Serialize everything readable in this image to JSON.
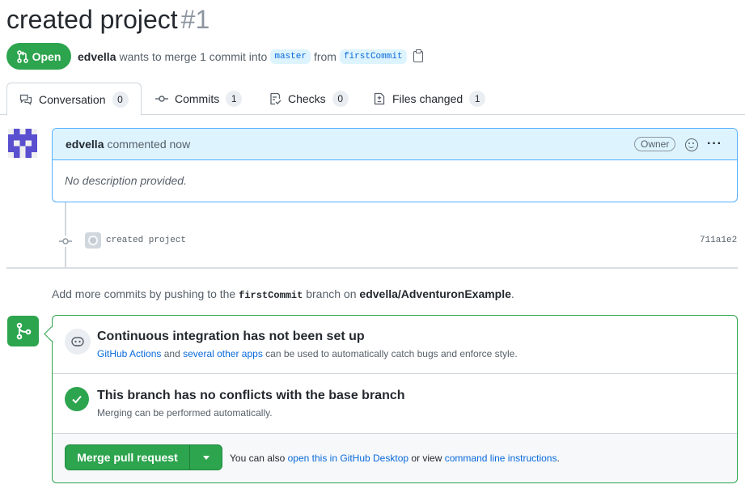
{
  "header": {
    "title": "created project",
    "number": "#1",
    "state": "Open",
    "author": "edvella",
    "meta_text": "wants to merge 1 commit into",
    "base_branch": "master",
    "from_text": "from",
    "head_branch": "firstCommit"
  },
  "tabs": [
    {
      "label": "Conversation",
      "count": "0",
      "icon": "comment-discussion-icon"
    },
    {
      "label": "Commits",
      "count": "1",
      "icon": "git-commit-icon"
    },
    {
      "label": "Checks",
      "count": "0",
      "icon": "checklist-icon"
    },
    {
      "label": "Files changed",
      "count": "1",
      "icon": "file-diff-icon"
    }
  ],
  "comment": {
    "author": "edvella",
    "action": "commented now",
    "label": "Owner",
    "more": "···",
    "body": "No description provided."
  },
  "commit": {
    "message": "created project",
    "sha": "711a1e2"
  },
  "push_hint": {
    "before": "Add more commits by pushing to the",
    "branch": "firstCommit",
    "middle": "branch on",
    "repo": "edvella/AdventuronExample",
    "after": "."
  },
  "merge_box": {
    "ci": {
      "title": "Continuous integration has not been set up",
      "link1": "GitHub Actions",
      "and": "and",
      "link2": "several other apps",
      "rest": "can be used to automatically catch bugs and enforce style."
    },
    "conflicts": {
      "title": "This branch has no conflicts with the base branch",
      "subtitle": "Merging can be performed automatically."
    },
    "merge": {
      "button_label": "Merge pull request",
      "alt_before": "You can also",
      "alt_link1": "open this in GitHub Desktop",
      "alt_middle": "or view",
      "alt_link2": "command line instructions",
      "alt_after": "."
    }
  },
  "colors": {
    "accent_green": "#2da44e",
    "link_blue": "#0969da",
    "comment_header_bg": "#ddf4ff"
  }
}
